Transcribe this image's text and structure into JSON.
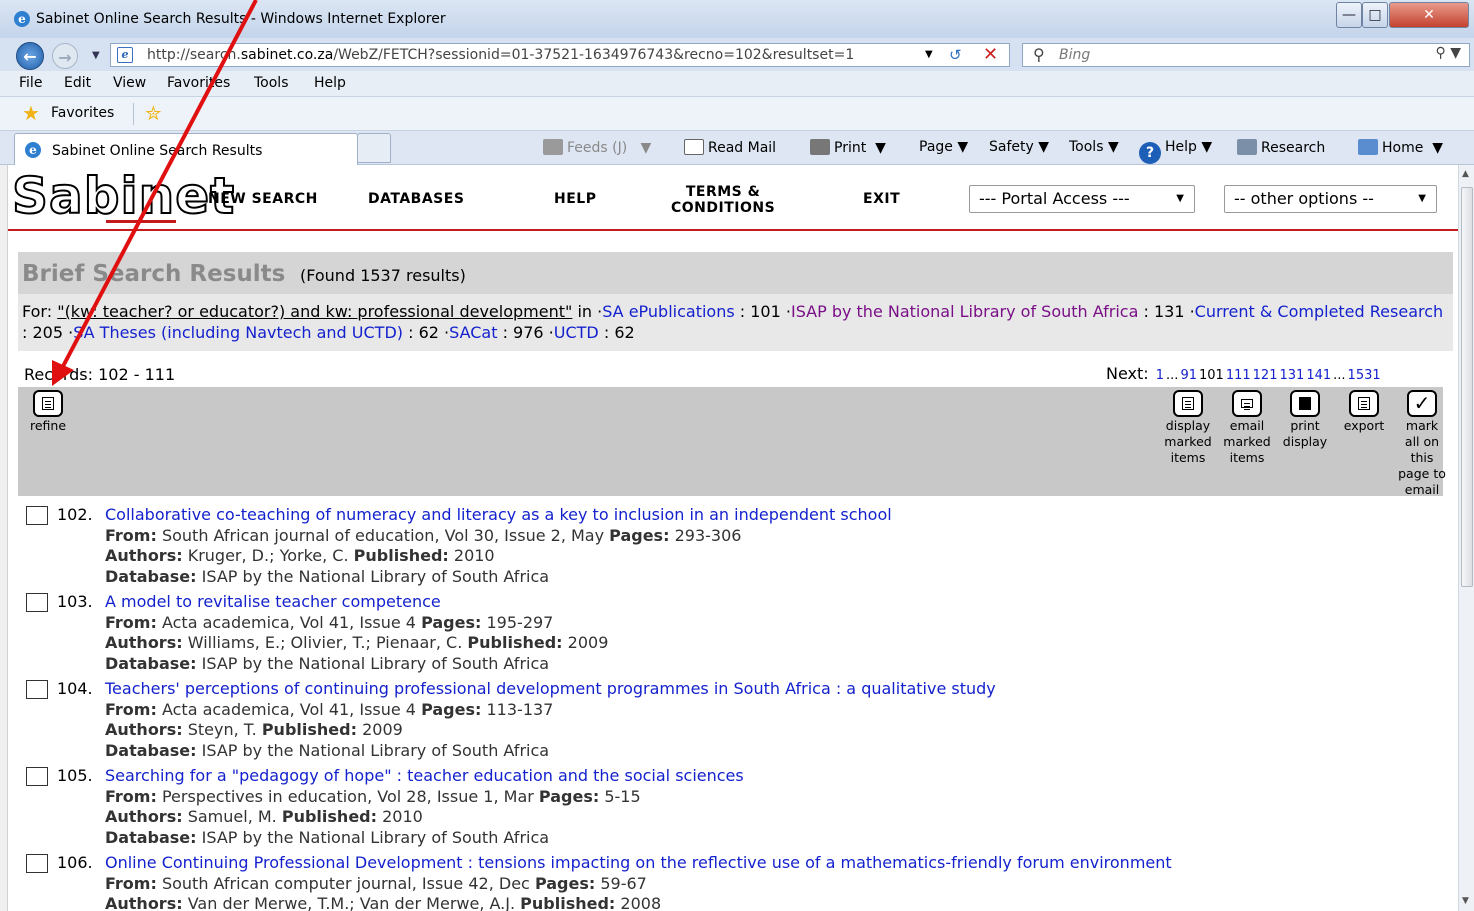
{
  "window": {
    "title": "Sabinet Online Search Results - Windows Internet Explorer",
    "minimize": "—",
    "maximize": "□",
    "close": "✕"
  },
  "address": {
    "url_prefix": "http://search.",
    "url_domain": "sabinet.co.za",
    "url_rest": "/WebZ/FETCH?sessionid=01-37521-1634976743&recno=102&resultset=1",
    "search_placeholder": "Bing"
  },
  "menu": [
    "File",
    "Edit",
    "View",
    "Favorites",
    "Tools",
    "Help"
  ],
  "favorites_label": "Favorites",
  "tab_label": "Sabinet Online Search Results",
  "commands": {
    "feeds": "Feeds (J)",
    "read_mail": "Read Mail",
    "print": "Print",
    "page": "Page",
    "safety": "Safety",
    "tools": "Tools",
    "help": "Help",
    "research": "Research",
    "home": "Home"
  },
  "site": {
    "logo": "Sabinet",
    "nav": {
      "new_search": "NEW SEARCH",
      "databases": "DATABASES",
      "help": "HELP",
      "terms_line1": "TERMS &",
      "terms_line2": "CONDITIONS",
      "exit": "EXIT"
    },
    "portal_select": "--- Portal Access ---",
    "options_select": "-- other options --"
  },
  "results_header": {
    "title": "Brief Search Results",
    "found": "(Found 1537 results)",
    "for_label": "For: ",
    "query": "\"(kw: teacher? or educator?) and kw: professional development\"",
    "in": " in ",
    "sources": [
      {
        "name": "SA ePublications",
        "count": "101",
        "color": "#1422ce"
      },
      {
        "name": "ISAP by the National Library of South Africa",
        "count": "131",
        "color": "#7a0f87"
      },
      {
        "name": "Current & Completed Research",
        "count": "205",
        "color": "#1422ce"
      },
      {
        "name": "SA Theses (including Navtech and UCTD)",
        "count": "62",
        "color": "#1422ce"
      },
      {
        "name": "SACat",
        "count": "976",
        "color": "#1422ce"
      },
      {
        "name": "UCTD",
        "count": "62",
        "color": "#1422ce"
      }
    ]
  },
  "records_label": "Records: 102 - 111",
  "pager": {
    "label": "Next:",
    "pages": [
      "1",
      "...",
      "91",
      "101",
      "111",
      "121",
      "131",
      "141",
      "...",
      "1531"
    ]
  },
  "toolbar": {
    "refine": "refine",
    "display_marked_1": "display",
    "display_marked_2": "marked",
    "display_marked_3": "items",
    "email_marked_1": "email",
    "email_marked_2": "marked",
    "email_marked_3": "items",
    "print_display_1": "print",
    "print_display_2": "display",
    "export": "export",
    "mark_1": "mark",
    "mark_2": "all on",
    "mark_3": "this",
    "mark_4": "page to",
    "mark_5": "email"
  },
  "labels": {
    "from": "From:",
    "pages": "Pages:",
    "authors": "Authors:",
    "published": "Published:",
    "database": "Database:"
  },
  "results": [
    {
      "num": "102.",
      "title": "Collaborative co-teaching of numeracy and literacy as a key to inclusion in an independent school",
      "from": "South African journal of education, Vol 30, Issue 2, May",
      "pages": "293-306",
      "authors": "Kruger, D.; Yorke, C.",
      "published": "2010",
      "database": "ISAP by the National Library of South Africa"
    },
    {
      "num": "103.",
      "title": "A model to revitalise teacher competence",
      "from": "Acta academica, Vol 41, Issue 4",
      "pages": "195-297",
      "authors": "Williams, E.; Olivier, T.; Pienaar, C.",
      "published": "2009",
      "database": "ISAP by the National Library of South Africa"
    },
    {
      "num": "104.",
      "title": "Teachers' perceptions of continuing professional development programmes in South Africa : a qualitative study",
      "from": "Acta academica, Vol 41, Issue 4",
      "pages": "113-137",
      "authors": "Steyn, T.",
      "published": "2009",
      "database": "ISAP by the National Library of South Africa"
    },
    {
      "num": "105.",
      "title": "Searching for a \"pedagogy of hope\" : teacher education and the social sciences",
      "from": "Perspectives in education, Vol 28, Issue 1, Mar",
      "pages": "5-15",
      "authors": "Samuel, M.",
      "published": "2010",
      "database": "ISAP by the National Library of South Africa"
    },
    {
      "num": "106.",
      "title": "Online Continuing Professional Development : tensions impacting on the reflective use of a mathematics-friendly forum environment",
      "from": "South African computer journal, Issue 42, Dec",
      "pages": "59-67",
      "authors": "Van der Merwe, T.M.; Van der Merwe, A.J.",
      "published": "2008",
      "database": ""
    }
  ],
  "colors": {
    "link": "#1422ce",
    "isap_link": "#7a0f87",
    "header_rule": "#c41d1d",
    "annotation_arrow": "#e01010"
  }
}
